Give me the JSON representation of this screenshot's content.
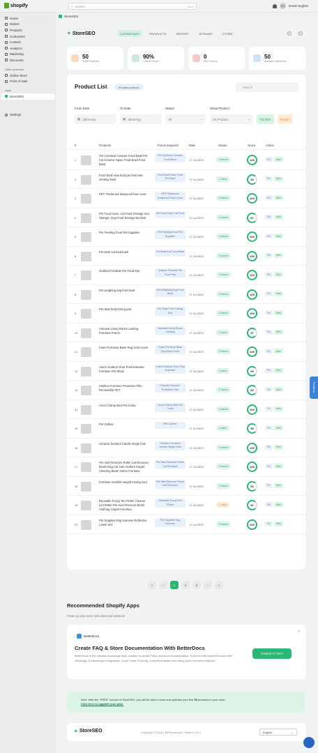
{
  "topbar": {
    "logo": "shopify",
    "search_placeholder": "Search",
    "search_kbd": "Ctrl K",
    "user_initials": "DH",
    "user_name": "David Hughes"
  },
  "sidebar": {
    "items": [
      "Home",
      "Orders",
      "Products",
      "Customers",
      "Content",
      "Analytics",
      "Marketing",
      "Discounts"
    ],
    "channels_label": "Sales channels",
    "channels": [
      "Online Store",
      "Point of Sale"
    ],
    "apps_label": "Apps",
    "apps": [
      "StoreSEO"
    ],
    "settings": "Settings"
  },
  "app": {
    "header_name": "StoreSEO",
    "brand": "StoreSEO",
    "nav": [
      "DASHBOARD",
      "PRODUCTS",
      "REPORT",
      "SITEMAP",
      "STORE"
    ]
  },
  "stats": [
    {
      "value": "50",
      "label": "Total Products",
      "color": "#f7d9b8"
    },
    {
      "value": "90%",
      "label": "Overall Score",
      "color": "#c9ecd9"
    },
    {
      "value": "0",
      "label": "SEO Issues",
      "color": "#f6c8c8"
    },
    {
      "value": "50",
      "label": "Already Optimized",
      "color": "#cfe0f5"
    }
  ],
  "product_list": {
    "title": "Product List",
    "badge": "50 total products",
    "search_placeholder": "Search",
    "filters": {
      "from_label": "From Date",
      "from_placeholder": "dd/mm/yy",
      "to_label": "To Date",
      "to_placeholder": "dd/mm/yy",
      "status_label": "Status",
      "status_value": "All",
      "show_label": "Show Product",
      "show_value": "20 Product",
      "filter_btn": "FILTER",
      "reset_btn": "RESET"
    },
    "columns": [
      "#",
      "Products",
      "Focus Keyword",
      "Date",
      "Issues",
      "Score",
      "Action"
    ],
    "fix_label": "Fix",
    "view_label": "View",
    "rows": [
      {
        "n": "1",
        "name": "Pet Cat Bowl Ceramic Food Bowl Pet Fat Ceramic Spine Food Bowl Food Bowl",
        "kw": "Pet Cat Bowl Ceramic Food Bowl",
        "date": "17 Jul 2023",
        "issues": "0 Issues",
        "score": "100",
        "warn": false
      },
      {
        "n": "2",
        "name": "Food bowl view food pet feed anti-choking bowl",
        "kw": "Food Bowl View Food Pet Bowl",
        "date": "17 Jul 2023",
        "issues": "1 Issue",
        "score": "94",
        "warn": false
      },
      {
        "n": "3",
        "name": "PET Thickened dustproof food cover",
        "kw": "PET Thickened Dustproof Food Cover",
        "date": "17 Jul 2023",
        "issues": "0 Issues",
        "score": "100",
        "warn": false
      },
      {
        "n": "4",
        "name": "Pet Food Cans, Cat Food Storage And Storage, Dog Food Storage Buckets",
        "kw": "Pet Food Cans Cat Food",
        "date": "17 Jul 2023",
        "issues": "2 Issues",
        "score": "87",
        "warn": false
      },
      {
        "n": "5",
        "name": "Pet Feeding Food Pet Supplies",
        "kw": "Pet Feeding Food Pet Supplies",
        "date": "17 Jul 2023",
        "issues": "0 Issues",
        "score": "100",
        "warn": false
      },
      {
        "n": "6",
        "name": "Pet bowl cat food bowl",
        "kw": "Pet Bowl Cat Food Bowl",
        "date": "17 Jul 2023",
        "issues": "0 Issues",
        "score": "100",
        "warn": false
      },
      {
        "n": "7",
        "name": "Outdoor Portable Pet Food Pan",
        "kw": "Outdoor Portable Pet Food Pan",
        "date": "17 Jul 2023",
        "issues": "0 Issues",
        "score": "100",
        "warn": false
      },
      {
        "n": "8",
        "name": "Pet weighing dog food bowl",
        "kw": "Pet Weighing Dog Food Bowl",
        "date": "17 Jul 2023",
        "issues": "0 Issues",
        "score": "100",
        "warn": false
      },
      {
        "n": "9",
        "name": "Pet slow food licking pad",
        "kw": "Pet Slow Food Licking Pad",
        "date": "17 Jul 2023",
        "issues": "0 Issues",
        "score": "100",
        "warn": false
      },
      {
        "n": "10",
        "name": "Arkmeat Living Room Landing Furniture Frame",
        "kw": "Arkmeat Living Room Landing",
        "date": "17 Jul 2023",
        "issues": "1 Issue",
        "score": "97",
        "warn": false
      },
      {
        "n": "11",
        "name": "Foam Furniture Base Rug Sofa Cover",
        "kw": "Foam Furniture Base Rug Sofa Cover",
        "date": "17 Jul 2023",
        "issues": "0 Issues",
        "score": "100",
        "warn": false
      },
      {
        "n": "12",
        "name": "Catch Outdoor Door Post Extender Furniture Pet Shed",
        "kw": "Catch Outdoor Door Post Extender",
        "date": "17 Jul 2023",
        "issues": "1 Issue",
        "score": "99",
        "warn": false
      },
      {
        "n": "13",
        "name": "Fashion Furniture Protective Film Removable PET",
        "kw": "Fashion Furniture Protective Film",
        "date": "17 Jul 2023",
        "issues": "2 Issues",
        "score": "84",
        "warn": false
      },
      {
        "n": "14",
        "name": "Acrun Clamp Bed Pet Comp",
        "kw": "Acrun Clamp Bed Pet Comp",
        "date": "17 Jul 2023",
        "issues": "0 Issues",
        "score": "100",
        "warn": false
      },
      {
        "n": "15",
        "name": "Pet clothes",
        "kw": "Pet Clothes",
        "date": "17 Jul 2023",
        "issues": "1 Issue",
        "score": "98",
        "warn": false
      },
      {
        "n": "16",
        "name": "Ceramic furniture handle single hole",
        "kw": "Ceramic Furniture Handle Single Hole",
        "date": "17 Jul 2023",
        "issues": "0 Issues",
        "score": "100",
        "warn": false
      },
      {
        "n": "17",
        "name": "Pet Hair Remover Roller Cat Remover Brush Dog Cat Hair Clothes Carpet Cleaning Brush Home Furniture",
        "kw": "Pet Hair Remover Roller Cat Remover",
        "date": "17 Jul 2023",
        "issues": "0 Issues",
        "score": "100",
        "warn": false
      },
      {
        "n": "18",
        "name": "Furniture invisible weight moving tool",
        "kw": "Pet Hair Remover Roller Lint Remover",
        "date": "17 Jul 2023",
        "issues": "2 Issues",
        "score": "83",
        "warn": false
      },
      {
        "n": "19",
        "name": "Reusable Fuzzy Ten Picker Cleaner Lint Roller Pet Hair Remover Brush Clothing Carpet Furniture",
        "kw": "Reusable Fuzzy Ten Picker",
        "date": "17 Jul 2023",
        "issues": "1 Issue",
        "score": "91",
        "warn": true
      },
      {
        "n": "20",
        "name": "Pet Supplies Dog Harness Reflective Leash Set",
        "kw": "Pet Supplies Dog Harness",
        "date": "17 Jul 2023",
        "issues": "0 Issues",
        "score": "100",
        "warn": false
      }
    ]
  },
  "pagination": {
    "pages": [
      "«",
      "‹",
      "1",
      "2",
      "3",
      "›",
      "»"
    ],
    "current": "1"
  },
  "recommended": {
    "title": "Recommended Shopify Apps",
    "subtitle": "Power up your store with advanced solutions",
    "app_logo": "BetterDocs",
    "app_title": "Create FAQ & Store Documentation With BetterDocs",
    "app_desc": "BetterDocs is the ultimate knowledge base solution to create FAQs and store documentation. It comes with Instant Answers with WhatsApp & Messenger Integrations, Quick Order Tracking, In-depth Analytics and many more exclusive features.",
    "cta": "CHECK IT OUT",
    "close": "×"
  },
  "notice": {
    "text": "Note: With the \"FREE\" version of StoreSEO, you will be able to scan and optimize your first",
    "count": "50",
    "text2": "products in your store.",
    "link": "Click here to upgrade your plan."
  },
  "footer": {
    "brand": "StoreSEO",
    "copyright": "Copyright © 2023 | WPDeveloper | Version 3.6.3",
    "lang": "English"
  },
  "feedback": "Feedback"
}
